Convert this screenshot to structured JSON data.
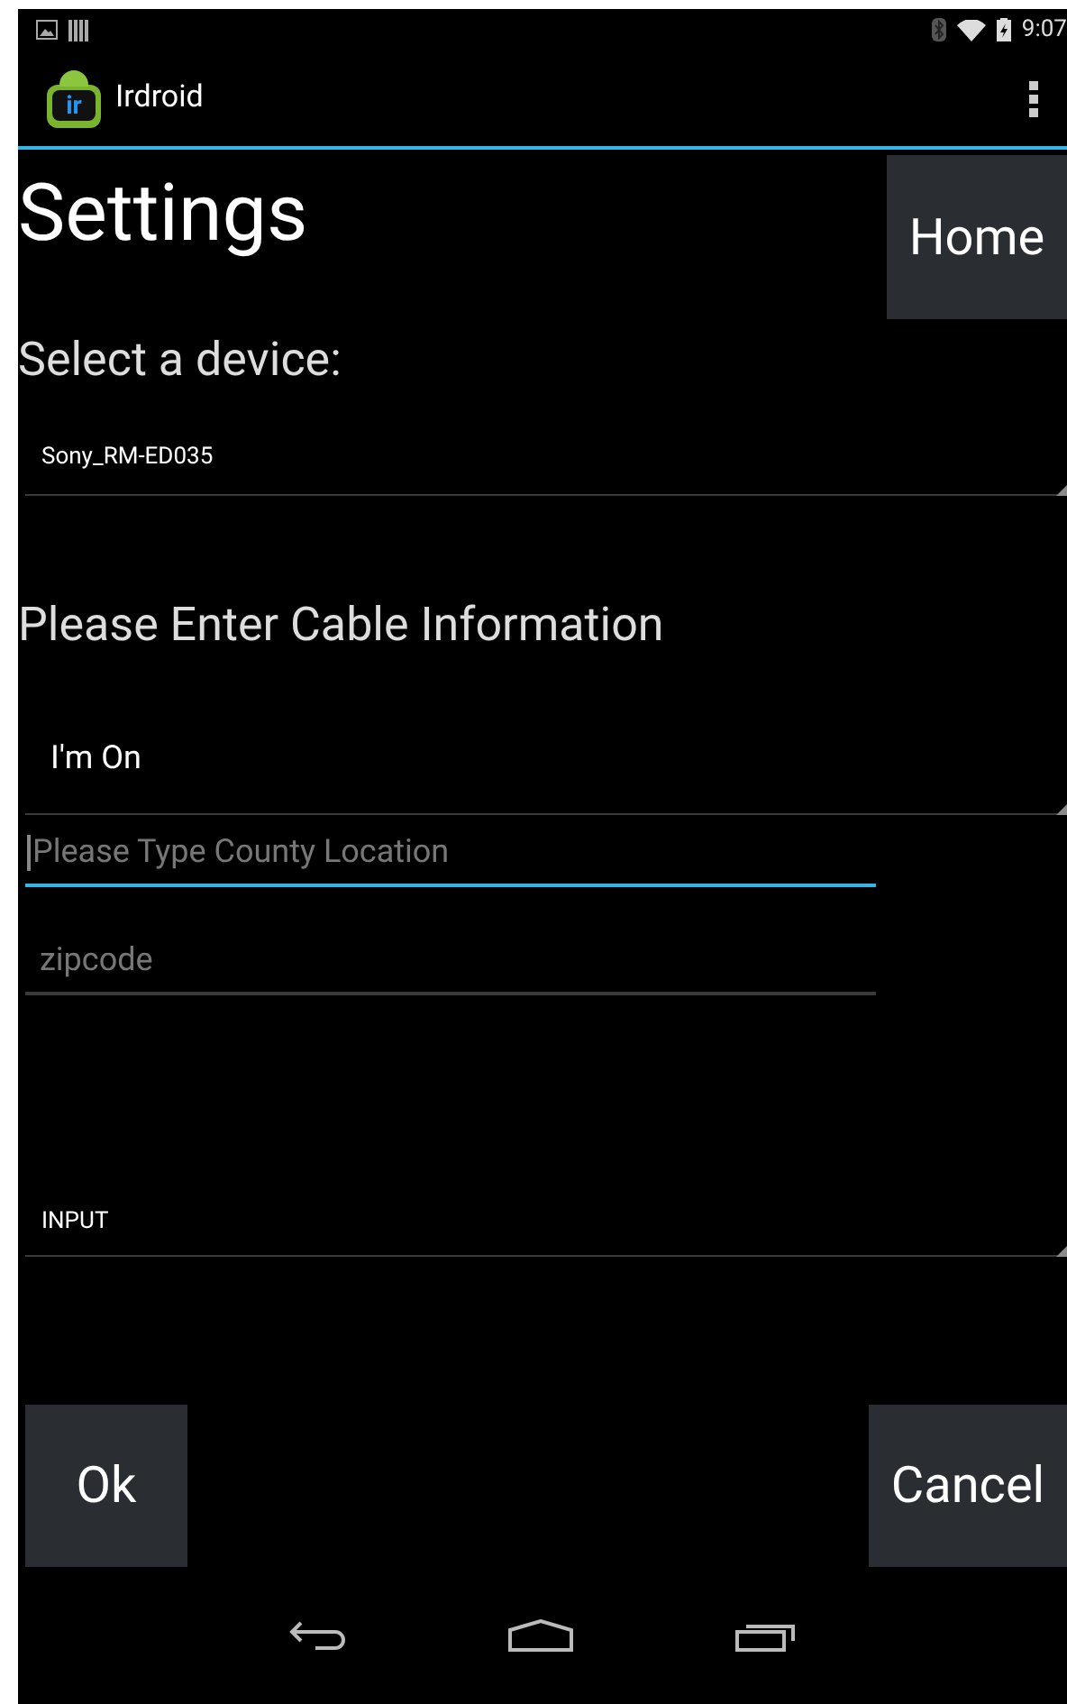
{
  "status_bar": {
    "time": "9:07"
  },
  "action_bar": {
    "title": "Irdroid",
    "logo_text": "ir"
  },
  "title": "Settings",
  "home_button": "Home",
  "device_label": "Select a device:",
  "device_spinner": {
    "value": "Sony_RM-ED035"
  },
  "cable_label": "Please Enter Cable Information",
  "provider_spinner": {
    "value": "I'm On"
  },
  "fields": [
    {
      "placeholder": "Please Type County Location",
      "focused": true
    },
    {
      "placeholder": "zipcode",
      "focused": false
    }
  ],
  "input_spinner": {
    "value": "INPUT"
  },
  "buttons": [
    {
      "label": "Ok"
    },
    {
      "label": "Cancel"
    }
  ]
}
